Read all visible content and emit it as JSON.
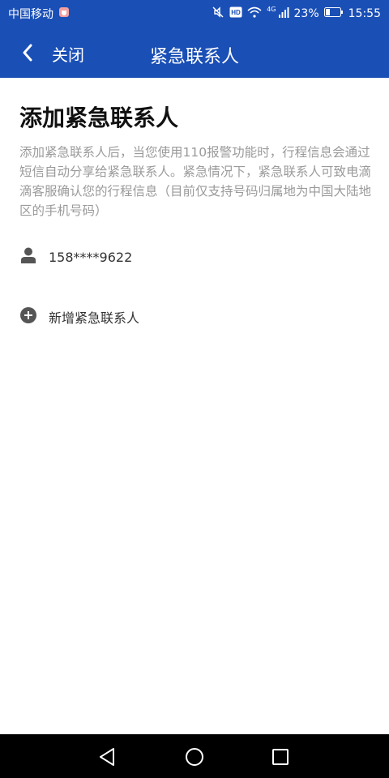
{
  "status_bar": {
    "carrier": "中国移动",
    "network": "4G",
    "battery": "23%",
    "time": "15:55",
    "icons": [
      "carrier-badge-icon",
      "mute-icon",
      "hd-icon",
      "wifi-icon",
      "signal-icon",
      "battery-icon"
    ]
  },
  "header": {
    "back_icon": "chevron-left-icon",
    "close_label": "关闭",
    "title": "紧急联系人"
  },
  "main": {
    "title": "添加紧急联系人",
    "description": "添加紧急联系人后，当您使用110报警功能时，行程信息会通过短信自动分享给紧急联系人。紧急情况下，紧急联系人可致电滴滴客服确认您的行程信息（目前仅支持号码归属地为中国大陆地区的手机号码）",
    "contacts": [
      {
        "icon": "person-icon",
        "phone": "158****9622"
      }
    ],
    "add_contact": {
      "icon": "plus-circle-icon",
      "label": "新增紧急联系人"
    }
  },
  "nav_bar": {
    "icons": [
      "back-triangle-icon",
      "home-circle-icon",
      "recent-square-icon"
    ]
  },
  "colors": {
    "primary": "#1a4fb6",
    "text_secondary": "#9a9a9a",
    "nav_background": "#000000"
  }
}
